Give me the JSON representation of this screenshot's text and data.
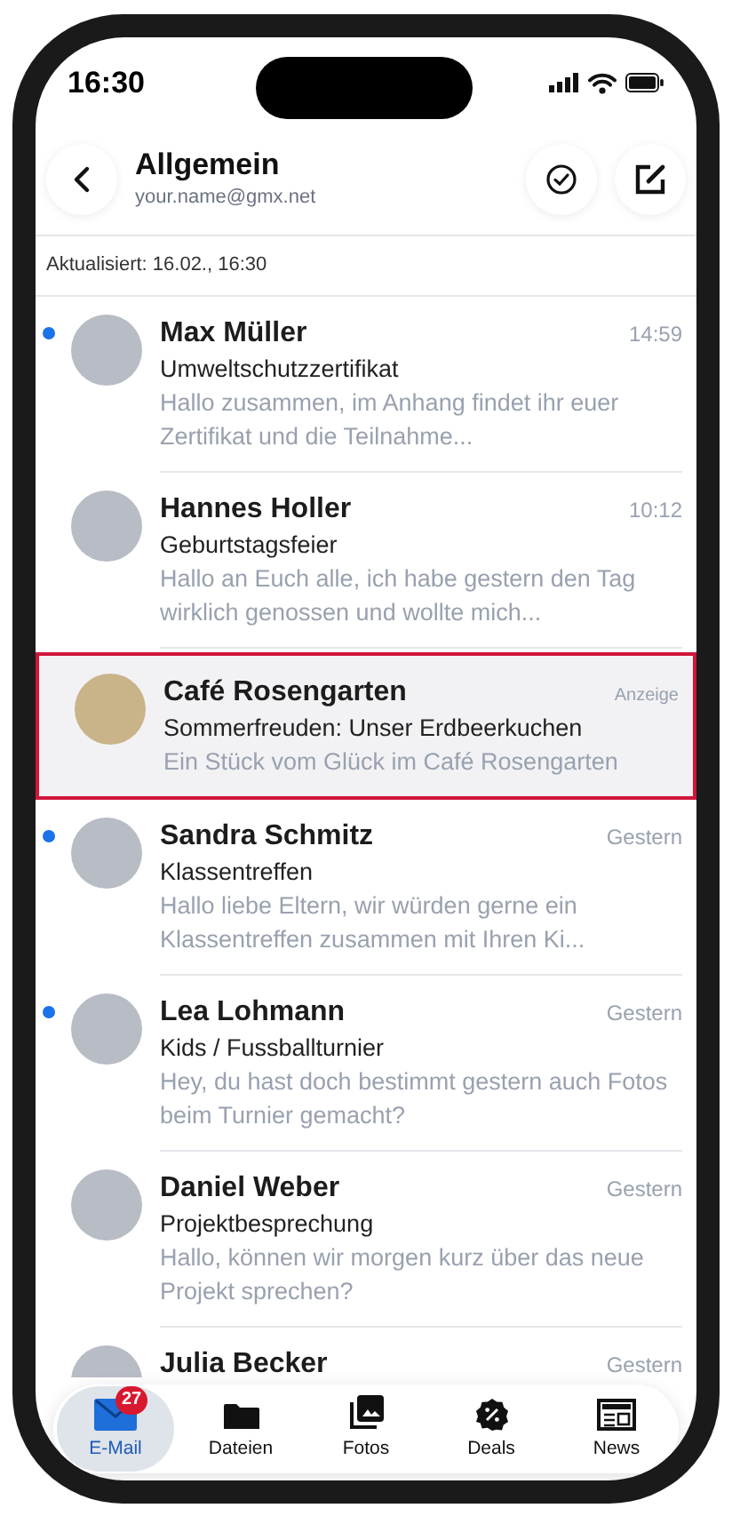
{
  "status_bar": {
    "time": "16:30"
  },
  "header": {
    "title": "Allgemein",
    "account": "your.name@gmx.net"
  },
  "updated": "Aktualisiert: 16.02., 16:30",
  "messages": [
    {
      "kind": "mail",
      "sender": "Max Müller",
      "time": "14:59",
      "subject": "Umweltschutzzertifikat",
      "preview": "Hallo zusammen, im Anhang findet ihr euer Zertifikat und die Teilnahme...",
      "unread": true
    },
    {
      "kind": "mail",
      "sender": "Hannes Holler",
      "time": "10:12",
      "subject": "Geburtstagsfeier",
      "preview": "Hallo an Euch alle, ich habe gestern den Tag wirklich genossen und wollte mich...",
      "unread": false
    },
    {
      "kind": "ad",
      "sender": "Café Rosengarten",
      "time": "Anzeige",
      "subject": "Sommerfreuden: Unser Erdbeerkuchen",
      "preview": "Ein Stück vom Glück im Café Rosengarten",
      "unread": false
    },
    {
      "kind": "mail",
      "sender": "Sandra Schmitz",
      "time": "Gestern",
      "subject": "Klassentreffen",
      "preview": "Hallo liebe Eltern, wir würden gerne ein Klassentreffen zusammen mit Ihren Ki...",
      "unread": true
    },
    {
      "kind": "mail",
      "sender": "Lea Lohmann",
      "time": "Gestern",
      "subject": "Kids / Fussballturnier",
      "preview": "Hey, du hast doch bestimmt gestern auch Fotos beim Turnier gemacht?",
      "unread": true
    },
    {
      "kind": "mail",
      "sender": "Daniel Weber",
      "time": "Gestern",
      "subject": "Projektbesprechung",
      "preview": "Hallo, können wir morgen kurz über das neue Projekt sprechen?",
      "unread": false
    },
    {
      "kind": "mail",
      "sender": "Julia Becker",
      "time": "Gestern",
      "unread": false
    }
  ],
  "tab_bar": [
    {
      "kind": "mail",
      "label": "E-Mail",
      "badge": "27",
      "selected": true
    },
    {
      "kind": "folder",
      "label": "Dateien",
      "selected": false
    },
    {
      "kind": "photos",
      "label": "Fotos",
      "selected": false
    },
    {
      "kind": "deals",
      "label": "Deals",
      "selected": false
    },
    {
      "kind": "news",
      "label": "News",
      "selected": false
    }
  ]
}
